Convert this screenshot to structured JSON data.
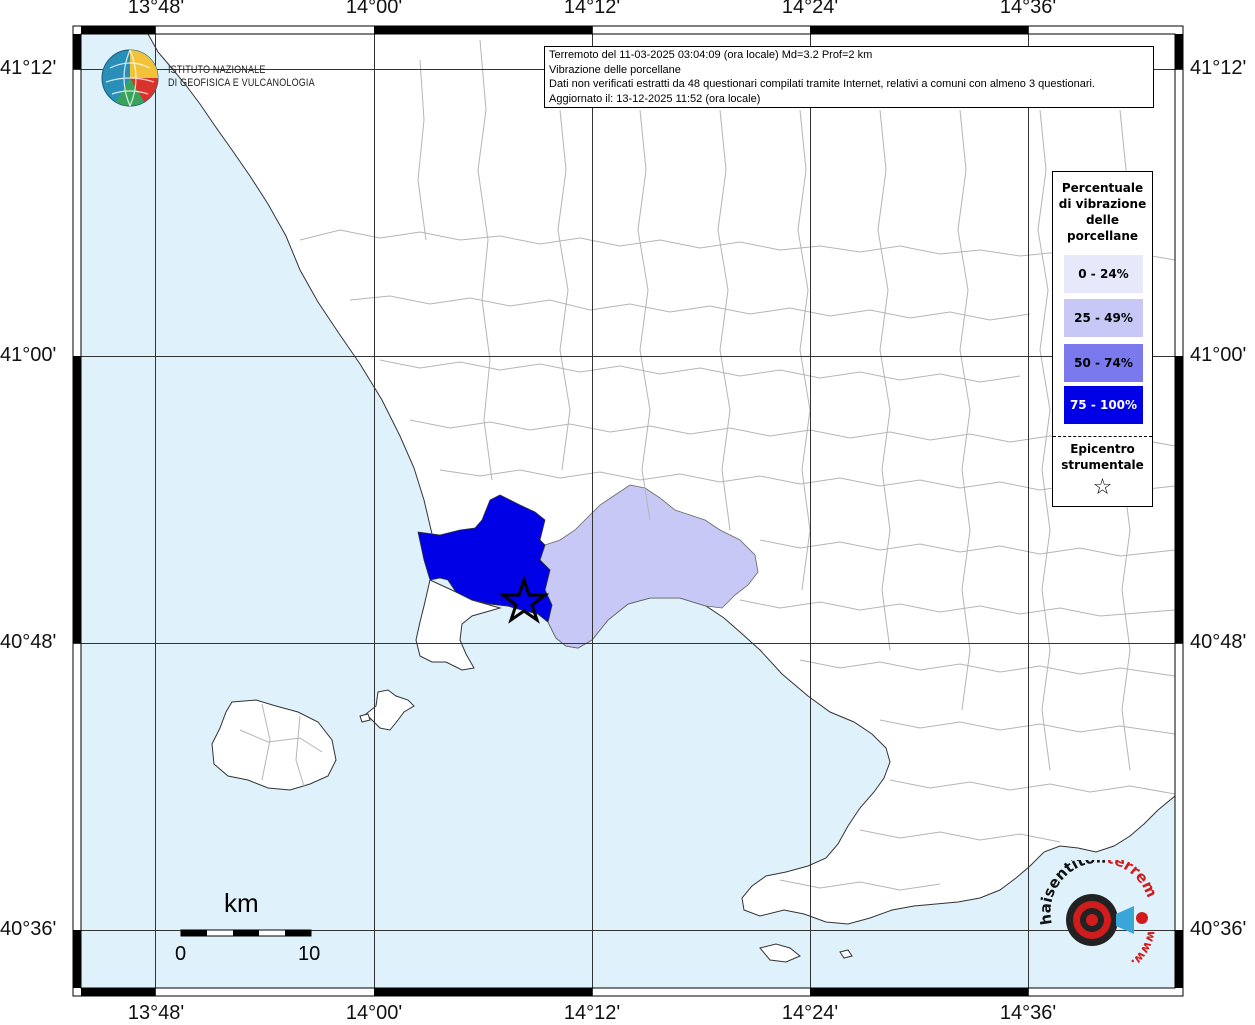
{
  "map": {
    "lon_labels": [
      "13°48'",
      "14°00'",
      "14°12'",
      "14°24'",
      "14°36'"
    ],
    "lat_labels": [
      "41°12'",
      "41°00'",
      "40°48'",
      "40°36'"
    ],
    "colors": {
      "sea": "#dff2fc",
      "land": "#ffffff",
      "border": "#b5b5b5",
      "class_0_24": "#e8e8fb",
      "class_25_49": "#c8c8f7",
      "class_50_74": "#7a7aee",
      "class_75_100": "#0000e6"
    }
  },
  "info": {
    "line1": "Terremoto del 11-03-2025 03:04:09 (ora locale) Md=3.2 Prof=2 km",
    "line2": "Vibrazione delle porcellane",
    "line3": "Dati non verificati estratti da 48 questionari compilati tramite Internet, relativi a comuni con almeno 3 questionari.",
    "line4": "Aggiornato il: 13-12-2025 11:52 (ora locale)"
  },
  "legend": {
    "title_lines": [
      "Percentuale",
      "di vibrazione",
      "delle",
      "porcellane"
    ],
    "classes": [
      {
        "label": "0 - 24%",
        "color": "#e8e8fb",
        "text_color": "#000000"
      },
      {
        "label": "25 - 49%",
        "color": "#c8c8f7",
        "text_color": "#000000"
      },
      {
        "label": "50 - 74%",
        "color": "#7a7aee",
        "text_color": "#000000"
      },
      {
        "label": "75 - 100%",
        "color": "#0000e6",
        "text_color": "#ffffff"
      }
    ],
    "epicenter_lines": [
      "Epicentro",
      "strumentale"
    ],
    "epicenter_symbol": "star-icon"
  },
  "logo": {
    "line1": "ISTITUTO NAZIONALE",
    "line2": "DI GEOFISICA E VULCANOLOGIA"
  },
  "scale": {
    "unit": "km",
    "start": "0",
    "end": "10"
  },
  "watermark": {
    "text": "haisentitoilterremoto.it",
    "url_text": "www."
  }
}
